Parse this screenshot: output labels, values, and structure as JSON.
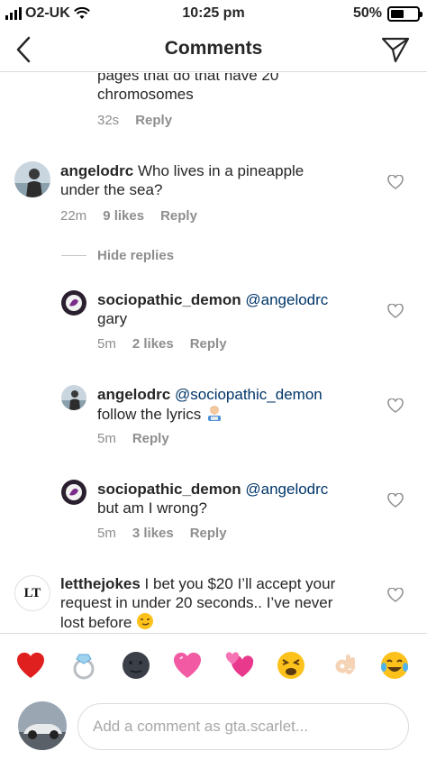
{
  "status_bar": {
    "carrier": "O2-UK",
    "time": "10:25 pm",
    "battery": "50%",
    "battery_level": 0.5
  },
  "header": {
    "title": "Comments"
  },
  "partial_comment": {
    "text_line1": "pages that do that have 20",
    "text_line2": "chromosomes",
    "time": "32s",
    "reply": "Reply"
  },
  "comments": [
    {
      "username": "angelodrc",
      "text_line1": "Who lives in a pineapple",
      "text_line2": "under the sea?",
      "time": "22m",
      "likes": "9 likes",
      "reply": "Reply"
    }
  ],
  "hide_replies": "Hide replies",
  "replies": [
    {
      "username": "sociopathic_demon",
      "mention": "@angelodrc",
      "text": "gary",
      "time": "5m",
      "likes": "2 likes",
      "reply": "Reply"
    },
    {
      "username": "angelodrc",
      "mention": "@sociopathic_demon",
      "text": "follow the lyrics",
      "time": "5m",
      "reply": "Reply"
    },
    {
      "username": "sociopathic_demon",
      "mention": "@angelodrc",
      "text": "but am I wrong?",
      "time": "5m",
      "likes": "3 likes",
      "reply": "Reply"
    }
  ],
  "last_comment": {
    "avatar_logo": "LT",
    "username": "letthejokes",
    "text_line1": "I bet you $20 I’ll accept your",
    "text_line2": "request in under 20 seconds.. I’ve never",
    "text_line3": "lost before"
  },
  "emoji_bar": [
    "red-heart",
    "ring",
    "new-moon-face",
    "pink-heart",
    "revolving-hearts",
    "tired-face",
    "ok-hand",
    "tears-of-joy"
  ],
  "composer": {
    "placeholder": "Add a comment as gta.scarlet..."
  }
}
